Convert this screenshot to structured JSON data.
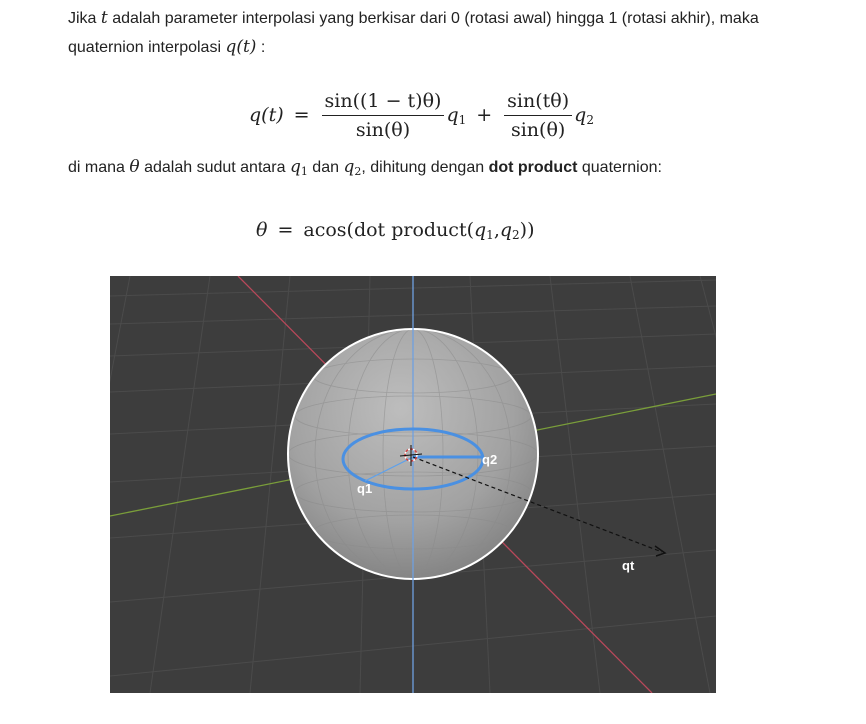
{
  "intro": {
    "t1": "Jika ",
    "var_t": "t",
    "t2": " adalah parameter interpolasi yang berkisar dari 0 (rotasi awal) hingga 1 (rotasi akhir), maka quaternion interpolasi ",
    "var_qt": "q(t)",
    "t3": " :"
  },
  "equation1": {
    "lhs": "q(t)",
    "eq": "=",
    "frac1_num": "sin((1 − t)θ)",
    "frac1_den": "sin(θ)",
    "q1": "q",
    "q1_sub": "1",
    "plus": "+",
    "frac2_num": "sin(tθ)",
    "frac2_den": "sin(θ)",
    "q2": "q",
    "q2_sub": "2"
  },
  "explain": {
    "t1": "di mana ",
    "var_theta": "θ",
    "t2": " adalah sudut antara ",
    "q1": "q",
    "q1_sub": "1",
    "t3": " dan ",
    "q2": "q",
    "q2_sub": "2",
    "t4": ", dihitung dengan ",
    "bold": "dot product",
    "t5": " quaternion:"
  },
  "equation2": {
    "lhs": "θ",
    "eq": "=",
    "rhs_a": "acos(dot product(",
    "q1": "q",
    "q1_sub": "1",
    "comma": ", ",
    "q2": "q",
    "q2_sub": "2",
    "rhs_b": "))"
  },
  "figure": {
    "label_q1": "q1",
    "label_q2": "q2",
    "label_qt": "qt",
    "colors": {
      "background": "#3d3d3d",
      "grid": "#4a4a4a",
      "x_axis": "#c8465a",
      "y_axis": "#7ea23c",
      "z_axis": "#6fa0e0",
      "sphere": "#9e9e9e",
      "outline": "#ffffff",
      "circle": "#4a90e2"
    }
  }
}
